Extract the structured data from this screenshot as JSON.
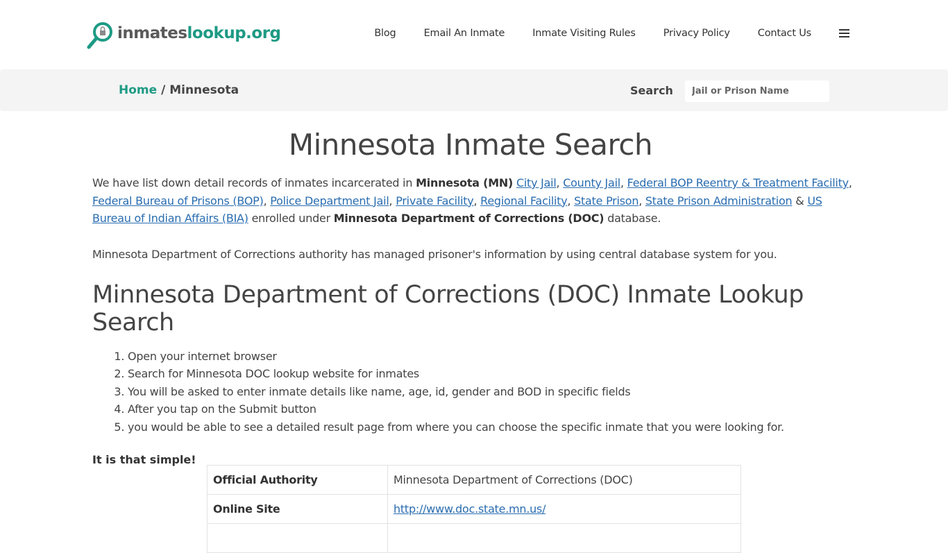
{
  "header": {
    "logo": {
      "part1": "inmates",
      "part2": "lookup.org",
      "icon": "magnifier-lock-icon"
    },
    "nav": [
      {
        "label": "Blog"
      },
      {
        "label": "Email An Inmate"
      },
      {
        "label": "Inmate Visiting Rules"
      },
      {
        "label": "Privacy Policy"
      },
      {
        "label": "Contact Us"
      }
    ],
    "menu_icon": "hamburger-icon"
  },
  "breadcrumb": {
    "home": "Home",
    "separator": " / ",
    "current": "Minnesota"
  },
  "search": {
    "label": "Search",
    "placeholder": "Jail or Prison Name",
    "value": ""
  },
  "main": {
    "title": "Minnesota Inmate Search",
    "intro": {
      "pre": "We have list down detail records of inmates incarcerated in ",
      "state_bold": "Minnesota (MN)",
      "links": [
        "City Jail",
        "County Jail",
        "Federal BOP Reentry & Treatment Facility",
        "Federal Bureau of Prisons (BOP)",
        "Police Department Jail",
        "Private Facility",
        "Regional Facility",
        "State Prison",
        "State Prison Administration",
        "US Bureau of Indian Affairs (BIA)"
      ],
      "sep": ", ",
      "amp": " & ",
      "mid": " enrolled under ",
      "dept_bold": "Minnesota Department of Corrections (DOC)",
      "post": " database."
    },
    "note": "Minnesota Department of Corrections authority has managed prisoner's information by using central database system for you.",
    "subheading": "Minnesota Department of Corrections (DOC) Inmate Lookup Search",
    "steps": [
      "Open your internet browser",
      "Search for Minnesota DOC lookup website for inmates",
      "You will be asked to enter inmate details like name, age, id, gender and BOD in specific fields",
      "After you tap on the Submit button",
      "you would be able to see a detailed result page from where you can choose the specific inmate that you were looking for."
    ],
    "simple": "It is that simple!",
    "table": [
      {
        "key": "Official Authority",
        "value": "Minnesota Department of Corrections (DOC)",
        "link": false
      },
      {
        "key": "Online Site",
        "value": "http://www.doc.state.mn.us/",
        "link": true
      },
      {
        "key": "",
        "value": "",
        "link": false
      }
    ]
  },
  "colors": {
    "brand_green": "#1e9a84",
    "logo_gray": "#5a5a5a",
    "link_blue": "#2a6db0",
    "crumb_bg": "#f4f4f4"
  }
}
